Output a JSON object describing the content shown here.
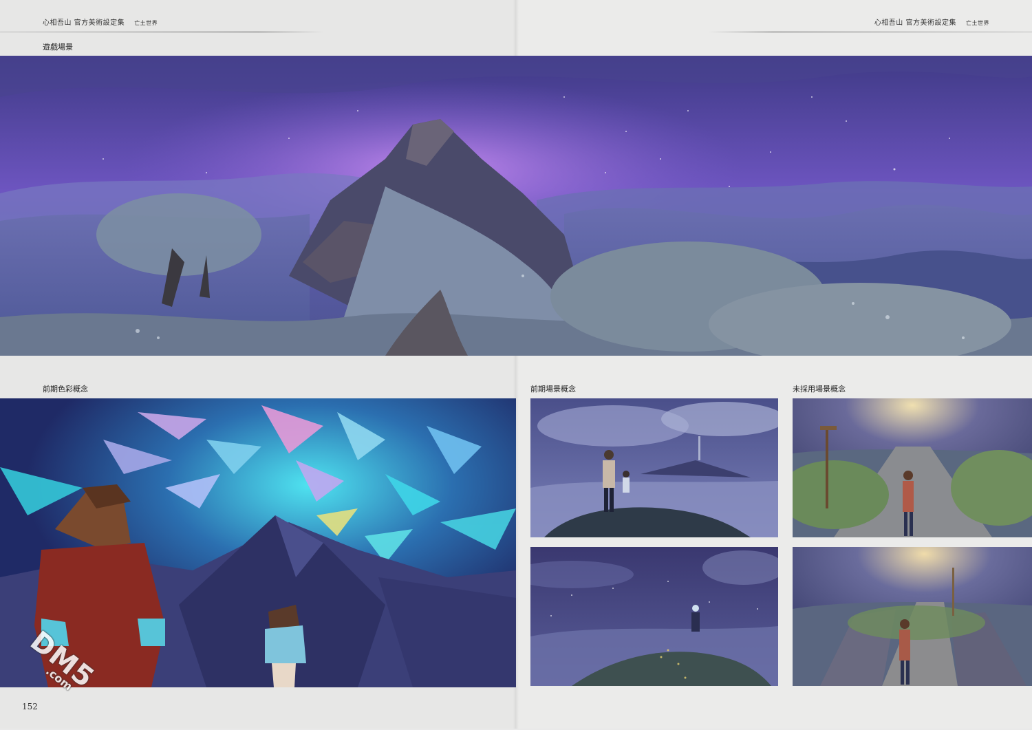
{
  "header": {
    "book_title_left": "心相吾山 官方美術設定集",
    "section_left": "亡土世界",
    "book_title_right": "心相吾山 官方美術設定集",
    "section_right": "亡土世界"
  },
  "captions": {
    "game_scene": "遊戲場景",
    "early_color_concept": "前期色彩概念",
    "early_scene_concept": "前期場景概念",
    "unused_scene_concept": "未採用場景概念"
  },
  "page_number": "152",
  "watermark": {
    "brand": "DM5",
    "domain": ".com"
  },
  "colors": {
    "page_bg": "#e8e8e7",
    "sky_purple": "#6b5fb0",
    "glow_magenta": "#b070e0",
    "fog_blue": "#5c6aa8",
    "shrub_gray": "#7c8ea0",
    "crystal_cyan": "#3fd6e8",
    "shirt_red": "#8a2a22"
  }
}
